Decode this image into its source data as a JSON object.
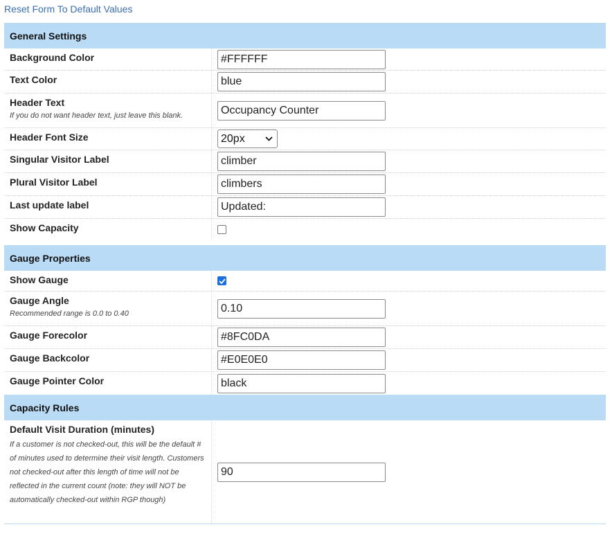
{
  "reset_link": "Reset Form To Default Values",
  "sections": {
    "general": {
      "title": "General Settings",
      "background_color": {
        "label": "Background Color",
        "value": "#FFFFFF"
      },
      "text_color": {
        "label": "Text Color",
        "value": "blue"
      },
      "header_text": {
        "label": "Header Text",
        "hint": "If you do not want header text, just leave this blank.",
        "value": "Occupancy Counter"
      },
      "header_font_size": {
        "label": "Header Font Size",
        "value": "20px"
      },
      "singular_label": {
        "label": "Singular Visitor Label",
        "value": "climber"
      },
      "plural_label": {
        "label": "Plural Visitor Label",
        "value": "climbers"
      },
      "last_update_label": {
        "label": "Last update label",
        "value": "Updated:"
      },
      "show_capacity": {
        "label": "Show Capacity",
        "checked": false
      }
    },
    "gauge": {
      "title": "Gauge Properties",
      "show_gauge": {
        "label": "Show Gauge",
        "checked": true
      },
      "gauge_angle": {
        "label": "Gauge Angle",
        "hint": "Recommended range is 0.0 to 0.40",
        "value": "0.10"
      },
      "forecolor": {
        "label": "Gauge Forecolor",
        "value": "#8FC0DA"
      },
      "backcolor": {
        "label": "Gauge Backcolor",
        "value": "#E0E0E0"
      },
      "pointer_color": {
        "label": "Gauge Pointer Color",
        "value": "black"
      }
    },
    "capacity": {
      "title": "Capacity Rules",
      "visit_duration": {
        "label": "Default Visit Duration (minutes)",
        "hint": "If a customer is not checked-out, this will be the default # of minutes used to determine their visit length. Customers not checked-out after this length of time will not be reflected in the current count (note: they will NOT be automatically checked-out within RGP though)",
        "value": "90"
      }
    }
  },
  "colors": {
    "section_header": "#b9dbf5",
    "link": "#3a6fb0",
    "checkbox_checked": "#1a6fe0"
  }
}
